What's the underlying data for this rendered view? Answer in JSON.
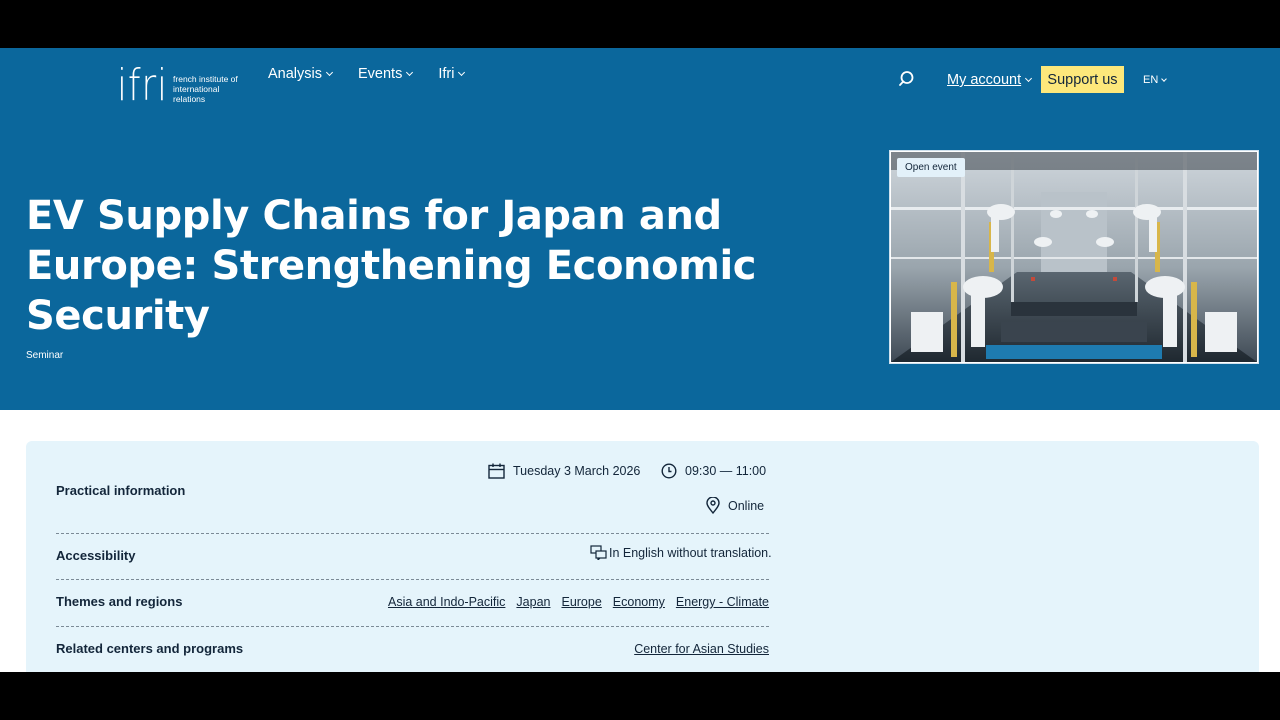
{
  "header": {
    "logo_text": "ifri",
    "logo_tagline": "french institute of international relations",
    "nav": [
      {
        "label": "Analysis"
      },
      {
        "label": "Events"
      },
      {
        "label": "Ifri"
      }
    ],
    "account_label": "My account",
    "support_label": "Support us",
    "lang_label": "EN"
  },
  "hero": {
    "title": "EV Supply Chains for Japan and Europe: Strengthening Economic Security",
    "subtitle": "Seminar",
    "badge": "Open event"
  },
  "practical": {
    "label": "Practical information",
    "date": "Tuesday 3 March 2026",
    "time": "09:30 — 11:00",
    "location": "Online"
  },
  "accessibility": {
    "label": "Accessibility",
    "value": "In English without translation."
  },
  "themes": {
    "label": "Themes and regions",
    "tags": [
      "Asia and Indo-Pacific",
      "Japan",
      "Europe",
      "Economy",
      "Energy - Climate"
    ]
  },
  "centers": {
    "label": "Related centers and programs",
    "tags": [
      "Center for Asian Studies"
    ]
  },
  "colors": {
    "brand_blue": "#0b679c",
    "support_yellow": "#fde87b",
    "card_bg": "#e5f4fb"
  }
}
